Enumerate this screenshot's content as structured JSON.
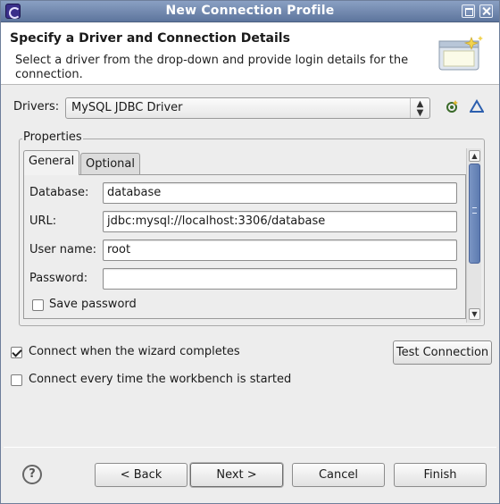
{
  "window": {
    "title": "New Connection Profile"
  },
  "banner": {
    "title": "Specify a Driver and Connection Details",
    "description": "Select a driver from the drop-down and provide login details for the connection."
  },
  "drivers": {
    "label": "Drivers:",
    "selected": "MySQL JDBC Driver"
  },
  "properties": {
    "legend": "Properties",
    "tabs": [
      {
        "label": "General",
        "active": true
      },
      {
        "label": "Optional",
        "active": false
      }
    ],
    "fields": {
      "database": {
        "label": "Database:",
        "value": "database"
      },
      "url": {
        "label": "URL:",
        "value": "jdbc:mysql://localhost:3306/database"
      },
      "username": {
        "label": "User name:",
        "value": "root"
      },
      "password": {
        "label": "Password:",
        "value": ""
      }
    },
    "save_password": {
      "label": "Save password",
      "checked": false
    }
  },
  "options": {
    "connect_on_finish": {
      "label": "Connect when the wizard completes",
      "checked": true
    },
    "connect_on_startup": {
      "label": "Connect every time the workbench is started",
      "checked": false
    }
  },
  "buttons": {
    "test_connection": "Test Connection",
    "back": "< Back",
    "next": "Next >",
    "cancel": "Cancel",
    "finish": "Finish",
    "help": "?"
  },
  "icons": {
    "app": "eclipse-icon",
    "new_driver": "new-driver-icon",
    "edit_driver": "edit-driver-icon",
    "wizard_banner": "database-wizard-icon"
  },
  "colors": {
    "titlebar": "#6f86ad",
    "scroll_thumb": "#5d7bb0"
  }
}
